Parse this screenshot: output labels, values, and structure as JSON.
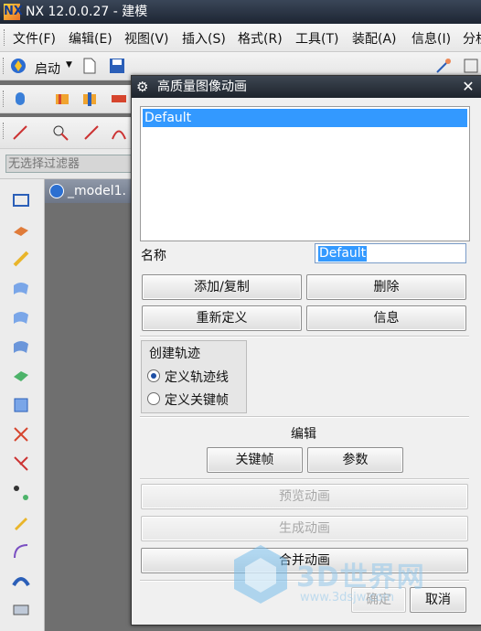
{
  "window": {
    "title": "NX 12.0.0.27 - 建模",
    "logo": "NX"
  },
  "menu": {
    "items": [
      "文件(F)",
      "编辑(E)",
      "视图(V)",
      "插入(S)",
      "格式(R)",
      "工具(T)",
      "装配(A)",
      "信息(I)",
      "分析"
    ]
  },
  "toolbar": {
    "start_label": "启动"
  },
  "selection_filter": {
    "placeholder": "无选择过滤器"
  },
  "graphics": {
    "tab_label": "_model1."
  },
  "dialog": {
    "title": "高质量图像动画",
    "list_items": [
      "Default"
    ],
    "name_label": "名称",
    "name_value": "Default",
    "buttons": {
      "add_copy": "添加/复制",
      "delete": "删除",
      "redefine": "重新定义",
      "info": "信息",
      "keyframe": "关键帧",
      "params": "参数",
      "preview": "预览动画",
      "generate": "生成动画",
      "merge": "合并动画",
      "ok": "确定",
      "cancel": "取消"
    },
    "create_track": {
      "title": "创建轨迹",
      "options": [
        "定义轨迹线",
        "定义关键帧"
      ],
      "selected": "定义轨迹线"
    },
    "edit_label": "编辑"
  },
  "watermark": {
    "text": "3D世界网",
    "url": "www.3dsjw.com"
  },
  "colors": {
    "selection": "#3399ff",
    "titlebar": "#1e242c",
    "graphics_bg": "#6f6f6f"
  }
}
